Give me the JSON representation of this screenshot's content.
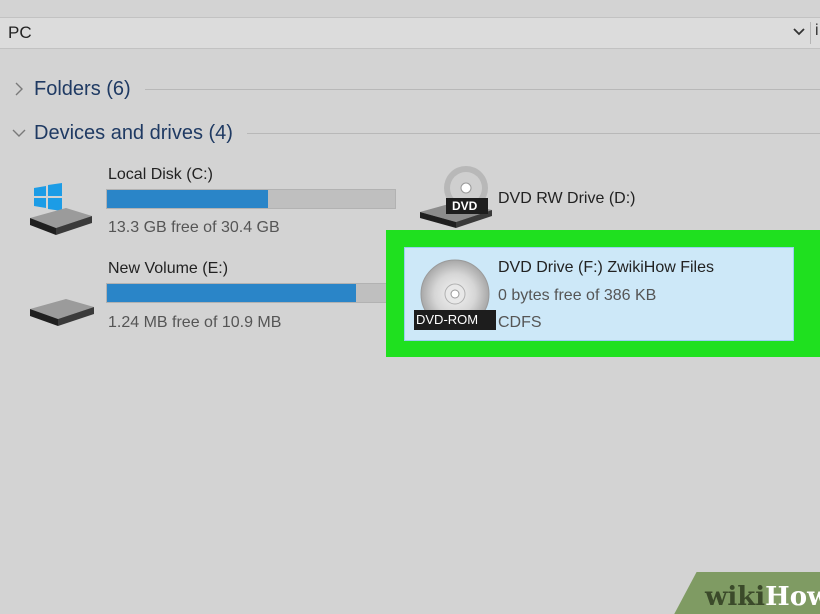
{
  "address_bar": {
    "path": "PC",
    "dropdown_icon": "chevron-down-icon",
    "overflow_glyph": "i"
  },
  "sections": {
    "folders": {
      "label": "Folders (6)",
      "expanded": false,
      "icon": "chevron-right-icon"
    },
    "devices": {
      "label": "Devices and drives (4)",
      "expanded": true,
      "icon": "chevron-down-icon"
    }
  },
  "drives": [
    {
      "name": "Local Disk (C:)",
      "details": "13.3 GB free of 30.4 GB",
      "used_fraction": 0.56,
      "icon": "windows-hard-drive-icon"
    },
    {
      "name": "New Volume (E:)",
      "details": "1.24 MB free of 10.9 MB",
      "used_fraction": 0.89,
      "icon": "hard-drive-icon"
    },
    {
      "name": "DVD RW Drive (D:)",
      "badge": "DVD",
      "icon": "dvd-drive-icon"
    },
    {
      "name": "DVD Drive (F:) ZwikiHow Files",
      "details": "0 bytes free of 386 KB",
      "filesystem": "CDFS",
      "badge": "DVD-ROM",
      "selected": true,
      "icon": "dvd-rom-disc-icon"
    }
  ],
  "colors": {
    "highlight": "#1fe01f",
    "selection": "#cde8f8",
    "usage_fill": "#2a85c8",
    "header_text": "#1f3a63"
  },
  "watermark": {
    "part1": "wiki",
    "part2": "How"
  }
}
